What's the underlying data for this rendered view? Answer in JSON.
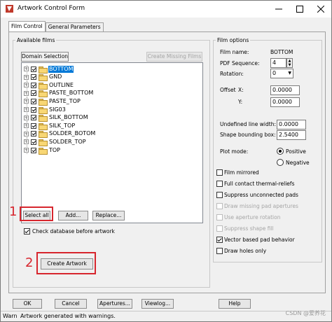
{
  "window": {
    "title": "Artwork Control Form"
  },
  "tabs": [
    {
      "label": "Film Control",
      "active": true
    },
    {
      "label": "General Parameters",
      "active": false
    }
  ],
  "available_films": {
    "group_label": "Available films",
    "domain_selection_label": "Domain Selection",
    "create_missing_label": "Create Missing Films",
    "films": [
      {
        "name": "BOTTOM",
        "checked": true,
        "selected": true
      },
      {
        "name": "GND",
        "checked": true,
        "selected": false
      },
      {
        "name": "OUTLINE",
        "checked": true,
        "selected": false
      },
      {
        "name": "PASTE_BOTTOM",
        "checked": true,
        "selected": false
      },
      {
        "name": "PASTE_TOP",
        "checked": true,
        "selected": false
      },
      {
        "name": "SIG03",
        "checked": true,
        "selected": false
      },
      {
        "name": "SILK_BOTTOM",
        "checked": true,
        "selected": false
      },
      {
        "name": "SILK_TOP",
        "checked": true,
        "selected": false
      },
      {
        "name": "SOLDER_BOTOM",
        "checked": true,
        "selected": false
      },
      {
        "name": "SOLDER_TOP",
        "checked": true,
        "selected": false
      },
      {
        "name": "TOP",
        "checked": true,
        "selected": false
      }
    ],
    "select_all_label": "Select all",
    "add_label": "Add...",
    "replace_label": "Replace...",
    "check_db_label": "Check database before artwork",
    "check_db_checked": true,
    "create_artwork_label": "Create Artwork"
  },
  "annotations": {
    "one": "1",
    "two": "2"
  },
  "film_options": {
    "group_label": "Film options",
    "film_name_label": "Film name:",
    "film_name_value": "BOTTOM",
    "pdf_sequence_label": "PDF Sequence:",
    "pdf_sequence_value": "4",
    "rotation_label": "Rotation:",
    "rotation_value": "0",
    "offset_label": "Offset",
    "offset_x_label": "X:",
    "offset_x_value": "0.0000",
    "offset_y_label": "Y:",
    "offset_y_value": "0.0000",
    "undefined_line_width_label": "Undefined line width:",
    "undefined_line_width_value": "0.0000",
    "shape_bounding_box_label": "Shape bounding box:",
    "shape_bounding_box_value": "2.5400",
    "plot_mode_label": "Plot mode:",
    "positive_label": "Positive",
    "negative_label": "Negative",
    "plot_mode": "Positive",
    "checkboxes": [
      {
        "label": "Film mirrored",
        "checked": false,
        "enabled": true
      },
      {
        "label": "Full contact thermal-reliefs",
        "checked": false,
        "enabled": true
      },
      {
        "label": "Suppress unconnected pads",
        "checked": false,
        "enabled": true
      },
      {
        "label": "Draw missing pad apertures",
        "checked": false,
        "enabled": false
      },
      {
        "label": "Use aperture rotation",
        "checked": false,
        "enabled": false
      },
      {
        "label": "Suppress shape fill",
        "checked": false,
        "enabled": false
      },
      {
        "label": "Vector based pad behavior",
        "checked": true,
        "enabled": true
      },
      {
        "label": "Draw holes only",
        "checked": false,
        "enabled": true
      }
    ]
  },
  "buttons": {
    "ok": "OK",
    "cancel": "Cancel",
    "apertures": "Apertures...",
    "viewlog": "Viewlog...",
    "help": "Help"
  },
  "status": {
    "level": "Warn",
    "message": "Artwork generated with warnings."
  },
  "watermark": "CSDN @爱养花"
}
